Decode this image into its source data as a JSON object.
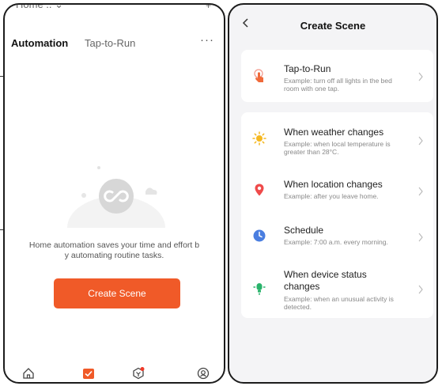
{
  "left_screen": {
    "status_home": "Home ..",
    "tabs": [
      "Automation",
      "Tap-to-Run"
    ],
    "more_icon": "more-horizontal-icon",
    "empty_message": "Home automation saves your time and effort by automating routine tasks.",
    "empty_line_1": "Home automation saves your time and effort b",
    "empty_line_2": "y automating routine tasks.",
    "create_button": "Create Scene",
    "nav_icons": [
      "home-icon",
      "scene-icon",
      "smart-icon",
      "profile-icon"
    ],
    "accent": "#f05a28"
  },
  "right_screen": {
    "title": "Create Scene",
    "back_icon": "back-icon",
    "options": [
      {
        "title": "Tap-to-Run",
        "subtitle_1": "Example: turn off all lights in the bed",
        "subtitle_2": "room with one tap.",
        "icon": "tap-hand-icon"
      },
      {
        "title": "When weather changes",
        "subtitle_1": "Example: when local temperature is",
        "subtitle_2": "greater than 28°C.",
        "icon": "sun-icon"
      },
      {
        "title": "When location changes",
        "subtitle_1": "Example: after you leave home.",
        "subtitle_2": "",
        "icon": "location-pin-icon"
      },
      {
        "title": "Schedule",
        "subtitle_1": "Example: 7:00 a.m. every morning.",
        "subtitle_2": "",
        "icon": "clock-icon"
      },
      {
        "title_1": "When device status",
        "title_2": "changes",
        "subtitle_1": "Example: when an unusual activity is",
        "subtitle_2": "detected.",
        "icon": "device-icon"
      }
    ]
  }
}
